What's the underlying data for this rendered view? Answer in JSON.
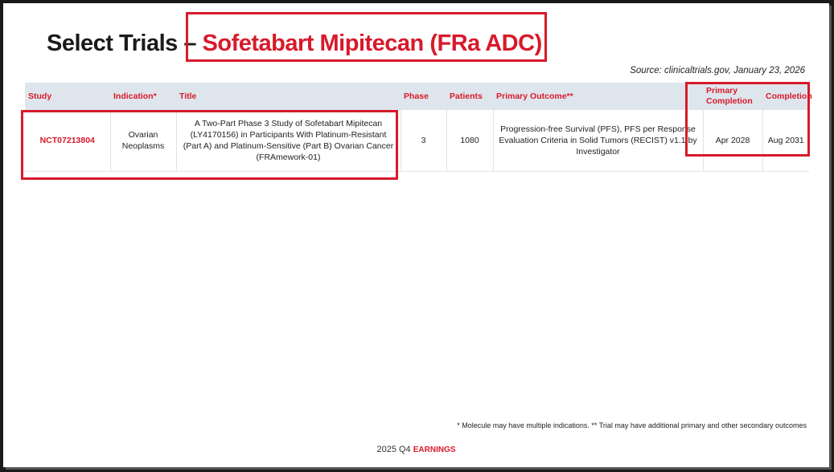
{
  "slide": {
    "title_prefix": "Select Trials",
    "title_dash": "–",
    "title_drug": "Sofetabart Mipitecan (FRa ADC)",
    "source": "Source: clinicaltrials.gov, January 23, 2026"
  },
  "table": {
    "headers": {
      "study": "Study",
      "indication": "Indication*",
      "title": "Title",
      "phase": "Phase",
      "patients": "Patients",
      "primary_outcome": "Primary Outcome**",
      "primary_completion": "Primary Completion",
      "completion": "Completion"
    },
    "rows": [
      {
        "study": "NCT07213804",
        "indication": "Ovarian Neoplasms",
        "title": "A Two-Part Phase 3 Study of Sofetabart Mipitecan (LY4170156) in Participants With Platinum-Resistant (Part A) and Platinum-Sensitive (Part B) Ovarian Cancer (FRAmework-01)",
        "phase": "3",
        "patients": "1080",
        "primary_outcome": "Progression-free Survival (PFS), PFS per Response Evaluation Criteria in Solid Tumors (RECIST) v1.1 by Investigator",
        "primary_completion": "Apr 2028",
        "completion": "Aug 2031"
      }
    ]
  },
  "footnote": "* Molecule may have multiple indications. ** Trial may have additional primary and other secondary outcomes",
  "footer": {
    "year": "2025 Q4",
    "label": "EARNINGS"
  }
}
